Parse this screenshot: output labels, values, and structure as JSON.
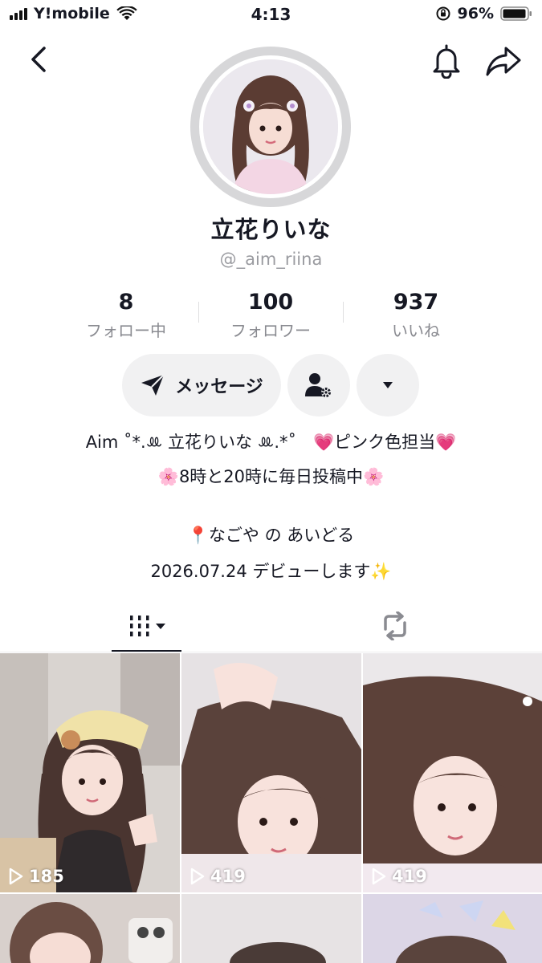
{
  "status_bar": {
    "carrier": "Y!mobile",
    "time": "4:13",
    "battery": "96%"
  },
  "profile": {
    "name": "立花りいな",
    "handle": "@_aim_riina"
  },
  "stats": [
    {
      "value": "8",
      "label": "フォロー中"
    },
    {
      "value": "100",
      "label": "フォロワー"
    },
    {
      "value": "937",
      "label": "いいね"
    }
  ],
  "actions": {
    "message_label": "メッセージ"
  },
  "bio": {
    "line1": "Aim ˚*.ꔛ 立花りいな ꔛ.*˚　💗ピンク色担当💗",
    "line2": "🌸8時と20時に毎日投稿中🌸",
    "line3": "📍なごや の あいどる",
    "line4": "2026.07.24 デビューします✨"
  },
  "videos": [
    {
      "views": "185"
    },
    {
      "views": "419"
    },
    {
      "views": "419"
    }
  ],
  "icons": {
    "back": "chevron-left-icon",
    "bell": "bell-icon",
    "share": "share-arrow-icon",
    "send": "paper-plane-icon",
    "friend": "person-gear-icon",
    "more": "caret-down-icon",
    "videos_tab": "grid-icon",
    "reposts_tab": "repost-icon",
    "play": "play-icon"
  },
  "colors": {
    "text": "#161823",
    "muted": "#8a8b91",
    "button_bg": "#f1f1f2"
  }
}
